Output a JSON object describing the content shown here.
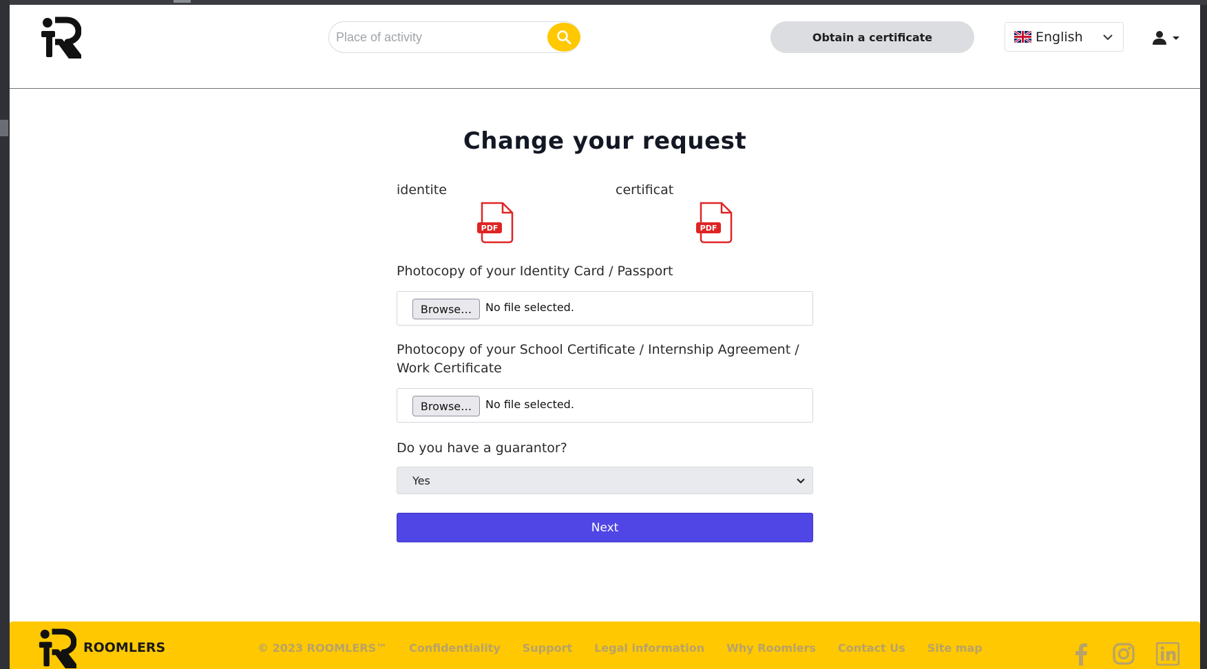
{
  "header": {
    "search_placeholder": "Place of activity",
    "cert_button": "Obtain a certificate",
    "language": "English"
  },
  "main": {
    "title": "Change your request",
    "documents": [
      {
        "label": "identite",
        "icon": "pdf-icon"
      },
      {
        "label": "certificat",
        "icon": "pdf-icon"
      }
    ],
    "identity_label": "Photocopy of your Identity Card / Passport",
    "certificate_label": "Photocopy of your School Certificate / Internship Agreement / Work Certificate",
    "browse_label": "Browse…",
    "no_file_text": "No file selected.",
    "guarantor_label": "Do you have a guarantor?",
    "guarantor_value": "Yes",
    "next_label": "Next"
  },
  "footer": {
    "brand": "ROOMLERS",
    "links": [
      "© 2023 ROOMLERS™",
      "Confidentiality",
      "Support",
      "Legal information",
      "Why Roomlers",
      "Contact Us",
      "Site map"
    ],
    "social": [
      "facebook-icon",
      "instagram-icon",
      "linkedin-icon"
    ]
  },
  "colors": {
    "accent_yellow": "#ffc800",
    "primary_button": "#4f46e5",
    "pdf_red": "#e02424"
  }
}
